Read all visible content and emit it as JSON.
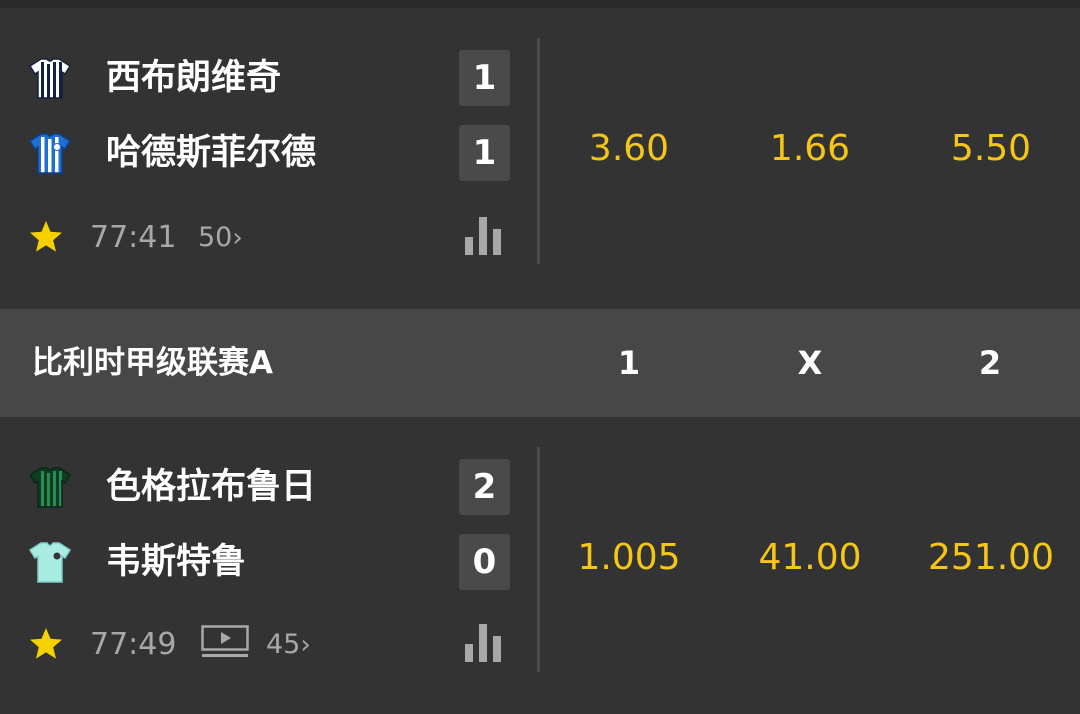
{
  "matches": [
    {
      "home": {
        "name": "西布朗维奇",
        "score": "1"
      },
      "away": {
        "name": "哈德斯菲尔德",
        "score": "1"
      },
      "time": "77:41",
      "market_count": "50",
      "odds": [
        "3.60",
        "1.66",
        "5.50"
      ],
      "has_live_video": false
    },
    {
      "home": {
        "name": "色格拉布鲁日",
        "score": "2"
      },
      "away": {
        "name": "韦斯特鲁",
        "score": "0"
      },
      "time": "77:49",
      "market_count": "45",
      "odds": [
        "1.005",
        "41.00",
        "251.00"
      ],
      "has_live_video": true
    }
  ],
  "league": {
    "name": "比利时甲级联赛A",
    "columns": [
      "1",
      "X",
      "2"
    ]
  },
  "icons": {
    "favorite": "star-icon",
    "stats": "bar-chart-icon",
    "live_video": "tv-play-icon",
    "more": "chevron-right-icon"
  },
  "colors": {
    "background": "#333333",
    "league_bar": "#474747",
    "odds": "#f5c518",
    "star": "#f5d100",
    "muted": "#a8a8a8"
  }
}
